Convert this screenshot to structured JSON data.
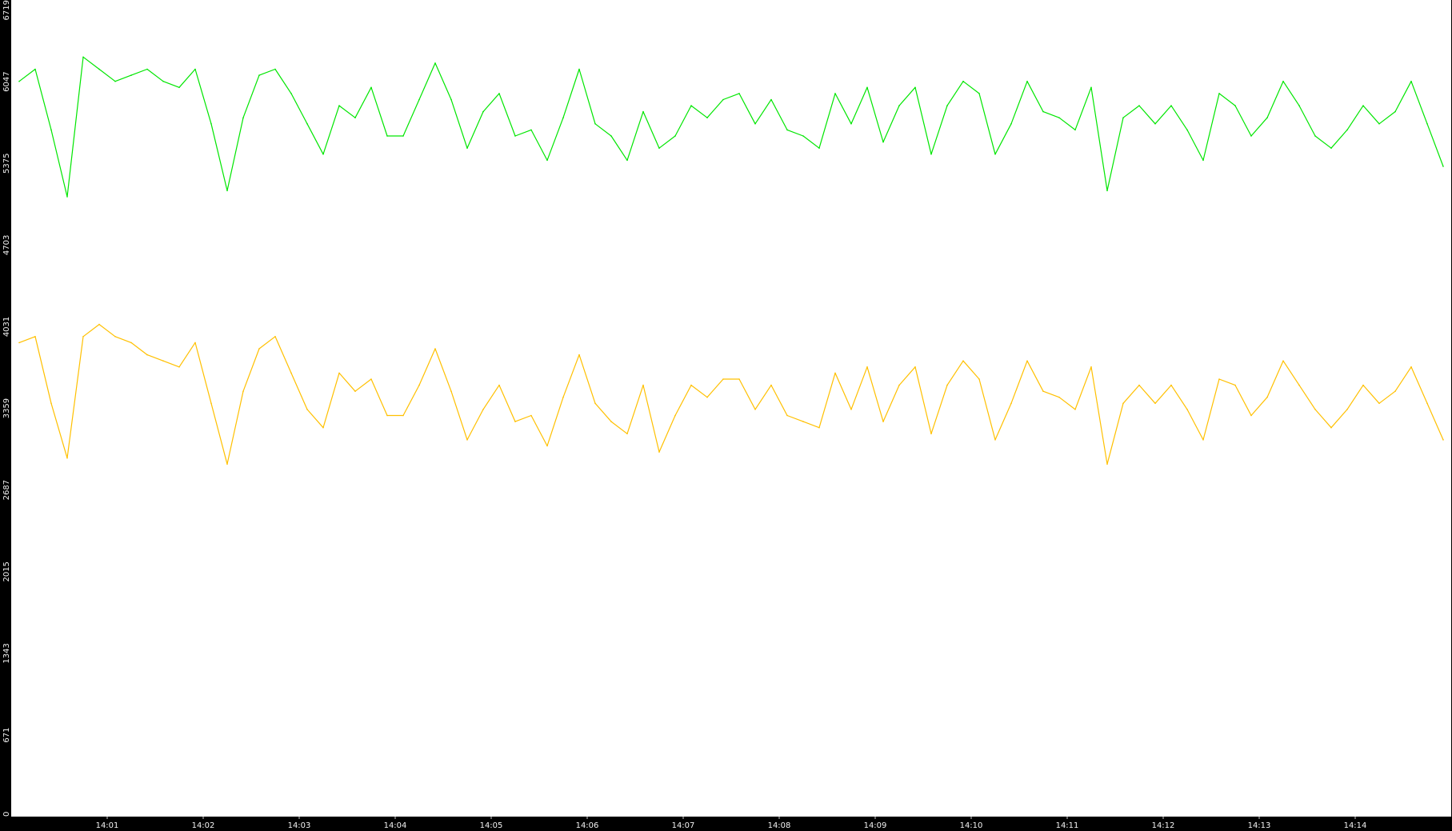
{
  "chart_data": {
    "type": "line",
    "title": "",
    "xlabel": "",
    "ylabel": "",
    "ylim": [
      0,
      6719
    ],
    "yticks": [
      0,
      671,
      1343,
      2015,
      2687,
      3359,
      4031,
      4703,
      5375,
      6047,
      6719
    ],
    "ytick_labels": [
      "0",
      "671",
      "1343",
      "2015",
      "2687",
      "3359",
      "4031",
      "4703",
      "5375",
      "6047",
      "6719"
    ],
    "xlim": [
      "14:00",
      "14:15"
    ],
    "xticks": [
      "14:01",
      "14:02",
      "14:03",
      "14:04",
      "14:05",
      "14:06",
      "14:07",
      "14:08",
      "14:09",
      "14:10",
      "14:11",
      "14:12",
      "14:13",
      "14:14"
    ],
    "grid": false,
    "legend": "none",
    "background_color": "#ffffff",
    "frame_color": "#000000",
    "series": [
      {
        "color": "#00e600",
        "x": [
          "14:00:05",
          "14:00:15",
          "14:00:25",
          "14:00:35",
          "14:00:45",
          "14:00:55",
          "14:01:05",
          "14:01:15",
          "14:01:25",
          "14:01:35",
          "14:01:45",
          "14:01:55",
          "14:02:05",
          "14:02:15",
          "14:02:25",
          "14:02:35",
          "14:02:45",
          "14:02:55",
          "14:03:05",
          "14:03:15",
          "14:03:25",
          "14:03:35",
          "14:03:45",
          "14:03:55",
          "14:04:05",
          "14:04:15",
          "14:04:25",
          "14:04:35",
          "14:04:45",
          "14:04:55",
          "14:05:05",
          "14:05:15",
          "14:05:25",
          "14:05:35",
          "14:05:45",
          "14:05:55",
          "14:06:05",
          "14:06:15",
          "14:06:25",
          "14:06:35",
          "14:06:45",
          "14:06:55",
          "14:07:05",
          "14:07:15",
          "14:07:25",
          "14:07:35",
          "14:07:45",
          "14:07:55",
          "14:08:05",
          "14:08:15",
          "14:08:25",
          "14:08:35",
          "14:08:45",
          "14:08:55",
          "14:09:05",
          "14:09:15",
          "14:09:25",
          "14:09:35",
          "14:09:45",
          "14:09:55",
          "14:10:05",
          "14:10:15",
          "14:10:25",
          "14:10:35",
          "14:10:45",
          "14:10:55",
          "14:11:05",
          "14:11:15",
          "14:11:25",
          "14:11:35",
          "14:11:45",
          "14:11:55",
          "14:12:05",
          "14:12:15",
          "14:12:25",
          "14:12:35",
          "14:12:45",
          "14:12:55",
          "14:13:05",
          "14:13:15",
          "14:13:25",
          "14:13:35",
          "14:13:45",
          "14:13:55",
          "14:14:05",
          "14:14:15",
          "14:14:25",
          "14:14:35",
          "14:14:45",
          "14:14:55"
        ],
        "y": [
          6050,
          6150,
          5650,
          5100,
          6250,
          6150,
          6050,
          6100,
          6150,
          6050,
          6000,
          6150,
          5700,
          5150,
          5750,
          6100,
          6150,
          5950,
          5700,
          5450,
          5850,
          5750,
          6000,
          5600,
          5600,
          5900,
          6200,
          5900,
          5500,
          5800,
          5950,
          5600,
          5650,
          5400,
          5750,
          6150,
          5700,
          5600,
          5400,
          5800,
          5500,
          5600,
          5850,
          5750,
          5900,
          5950,
          5700,
          5900,
          5650,
          5600,
          5500,
          5950,
          5700,
          6000,
          5550,
          5850,
          6000,
          5450,
          5850,
          6050,
          5950,
          5450,
          5700,
          6050,
          5800,
          5750,
          5650,
          6000,
          5150,
          5750,
          5850,
          5700,
          5850,
          5650,
          5400,
          5950,
          5850,
          5600,
          5750,
          6050,
          5850,
          5600,
          5500,
          5650,
          5850,
          5700,
          5800,
          6050,
          5700,
          5350
        ]
      },
      {
        "color": "#ffc000",
        "x": [
          "14:00:05",
          "14:00:15",
          "14:00:25",
          "14:00:35",
          "14:00:45",
          "14:00:55",
          "14:01:05",
          "14:01:15",
          "14:01:25",
          "14:01:35",
          "14:01:45",
          "14:01:55",
          "14:02:05",
          "14:02:15",
          "14:02:25",
          "14:02:35",
          "14:02:45",
          "14:02:55",
          "14:03:05",
          "14:03:15",
          "14:03:25",
          "14:03:35",
          "14:03:45",
          "14:03:55",
          "14:04:05",
          "14:04:15",
          "14:04:25",
          "14:04:35",
          "14:04:45",
          "14:04:55",
          "14:05:05",
          "14:05:15",
          "14:05:25",
          "14:05:35",
          "14:05:45",
          "14:05:55",
          "14:06:05",
          "14:06:15",
          "14:06:25",
          "14:06:35",
          "14:06:45",
          "14:06:55",
          "14:07:05",
          "14:07:15",
          "14:07:25",
          "14:07:35",
          "14:07:45",
          "14:07:55",
          "14:08:05",
          "14:08:15",
          "14:08:25",
          "14:08:35",
          "14:08:45",
          "14:08:55",
          "14:09:05",
          "14:09:15",
          "14:09:25",
          "14:09:35",
          "14:09:45",
          "14:09:55",
          "14:10:05",
          "14:10:15",
          "14:10:25",
          "14:10:35",
          "14:10:45",
          "14:10:55",
          "14:11:05",
          "14:11:15",
          "14:11:25",
          "14:11:35",
          "14:11:45",
          "14:11:55",
          "14:12:05",
          "14:12:15",
          "14:12:25",
          "14:12:35",
          "14:12:45",
          "14:12:55",
          "14:13:05",
          "14:13:15",
          "14:13:25",
          "14:13:35",
          "14:13:45",
          "14:13:55",
          "14:14:05",
          "14:14:15",
          "14:14:25",
          "14:14:35",
          "14:14:45",
          "14:14:55"
        ],
        "y": [
          3900,
          3950,
          3400,
          2950,
          3950,
          4050,
          3950,
          3900,
          3800,
          3750,
          3700,
          3900,
          3400,
          2900,
          3500,
          3850,
          3950,
          3650,
          3350,
          3200,
          3650,
          3500,
          3600,
          3300,
          3300,
          3550,
          3850,
          3500,
          3100,
          3350,
          3550,
          3250,
          3300,
          3050,
          3450,
          3800,
          3400,
          3250,
          3150,
          3550,
          3000,
          3300,
          3550,
          3450,
          3600,
          3600,
          3350,
          3550,
          3300,
          3250,
          3200,
          3650,
          3350,
          3700,
          3250,
          3550,
          3700,
          3150,
          3550,
          3750,
          3600,
          3100,
          3400,
          3750,
          3500,
          3450,
          3350,
          3700,
          2900,
          3400,
          3550,
          3400,
          3550,
          3350,
          3100,
          3600,
          3550,
          3300,
          3450,
          3750,
          3550,
          3350,
          3200,
          3350,
          3550,
          3400,
          3500,
          3700,
          3400,
          3100
        ]
      }
    ]
  }
}
